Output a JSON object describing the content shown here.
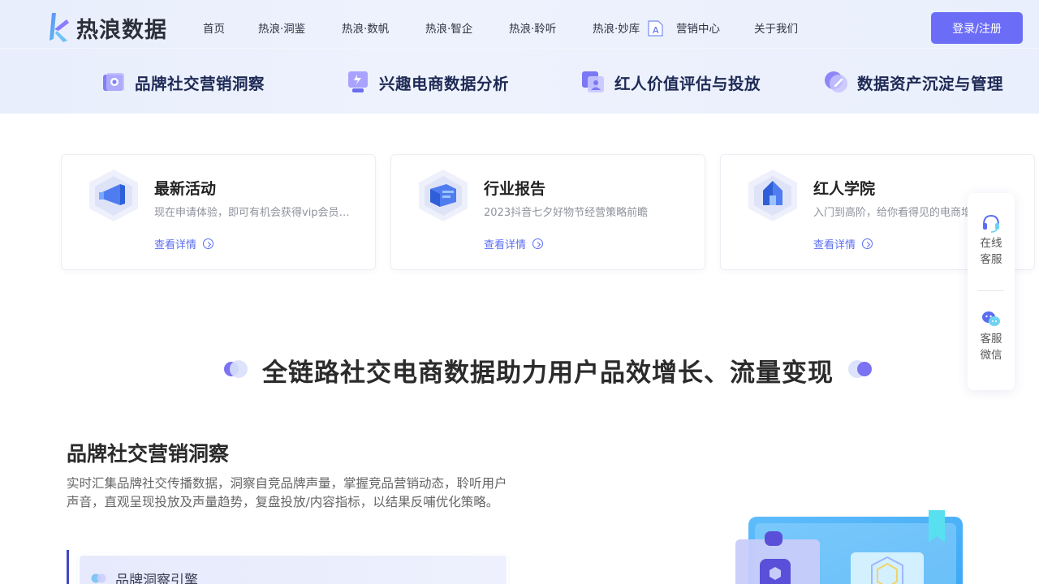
{
  "header": {
    "brand": "热浪数据",
    "nav": [
      {
        "label": "首页"
      },
      {
        "label": "热浪·洞鉴"
      },
      {
        "label": "热浪·数帆"
      },
      {
        "label": "热浪·智企"
      },
      {
        "label": "热浪·聆听"
      },
      {
        "label": "热浪·妙库"
      },
      {
        "label": "营销中心"
      },
      {
        "label": "关于我们"
      }
    ],
    "login_label": "登录/注册"
  },
  "features": [
    {
      "label": "品牌社交营销洞察",
      "icon": "camera-icon"
    },
    {
      "label": "兴趣电商数据分析",
      "icon": "live-stream-icon"
    },
    {
      "label": "红人价值评估与投放",
      "icon": "influencer-icon"
    },
    {
      "label": "数据资产沉淀与管理",
      "icon": "data-disc-icon"
    }
  ],
  "cards": [
    {
      "title": "最新活动",
      "desc": "现在申请体验，即可有机会获得vip会员体验资格",
      "link": "查看详情",
      "icon": "megaphone-icon"
    },
    {
      "title": "行业报告",
      "desc": "2023抖音七夕好物节经营策略前瞻",
      "link": "查看详情",
      "icon": "report-icon"
    },
    {
      "title": "红人学院",
      "desc": "入门到高阶，给你看得见的电商增长",
      "link": "查看详情",
      "icon": "academy-icon"
    }
  ],
  "service": {
    "online_label_1": "在线",
    "online_label_2": "客服",
    "wechat_label_1": "客服",
    "wechat_label_2": "微信"
  },
  "headline": "全链路社交电商数据助力用户品效增长、流量变现",
  "section": {
    "title": "品牌社交营销洞察",
    "desc": "实时汇集品牌社交传播数据，洞察自竞品牌声量，掌握竞品营销动态，聆听用户声音，直观呈现投放及声量趋势，复盘投放/内容指标，以结果反哺优化策略。",
    "engine_title": "品牌洞察引擎"
  },
  "colors": {
    "accent": "#6c6df7",
    "link": "#5a6ef0",
    "nav_text": "#2d3140"
  }
}
